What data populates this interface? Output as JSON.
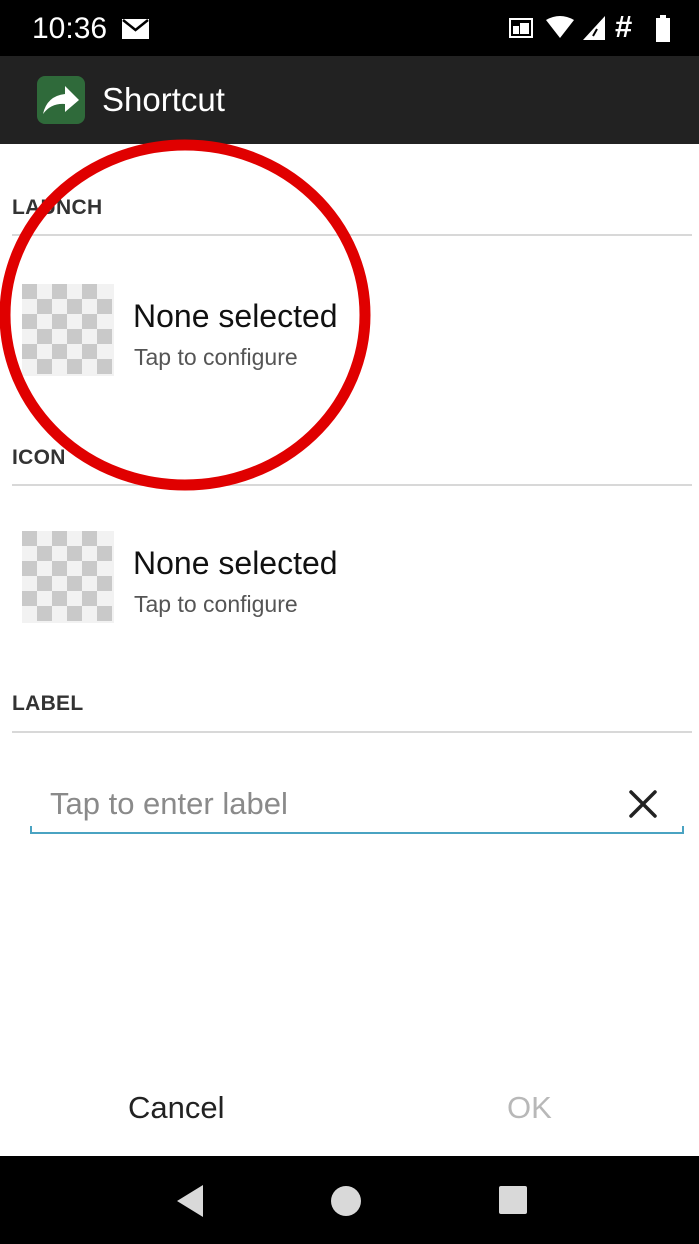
{
  "status_bar": {
    "time": "10:36",
    "icons": [
      "mail-icon",
      "cast-icon",
      "wifi-icon",
      "signal-icon",
      "hash-icon",
      "battery-icon"
    ],
    "hash_glyph": "#"
  },
  "app_bar": {
    "title": "Shortcut",
    "icon": "share-arrow-icon"
  },
  "sections": {
    "launch": {
      "header": "LAUNCH",
      "title": "None selected",
      "subtitle": "Tap to configure"
    },
    "icon": {
      "header": "ICON",
      "title": "None selected",
      "subtitle": "Tap to configure"
    },
    "label": {
      "header": "LABEL",
      "placeholder": "Tap to enter label",
      "value": ""
    }
  },
  "dialog_actions": {
    "cancel_label": "Cancel",
    "ok_label": "OK"
  },
  "colors": {
    "accent_line": "#4aa3c2",
    "annotation_circle": "#e00000",
    "app_bar_bg": "#222222",
    "disabled_text": "#b8b8b8"
  }
}
